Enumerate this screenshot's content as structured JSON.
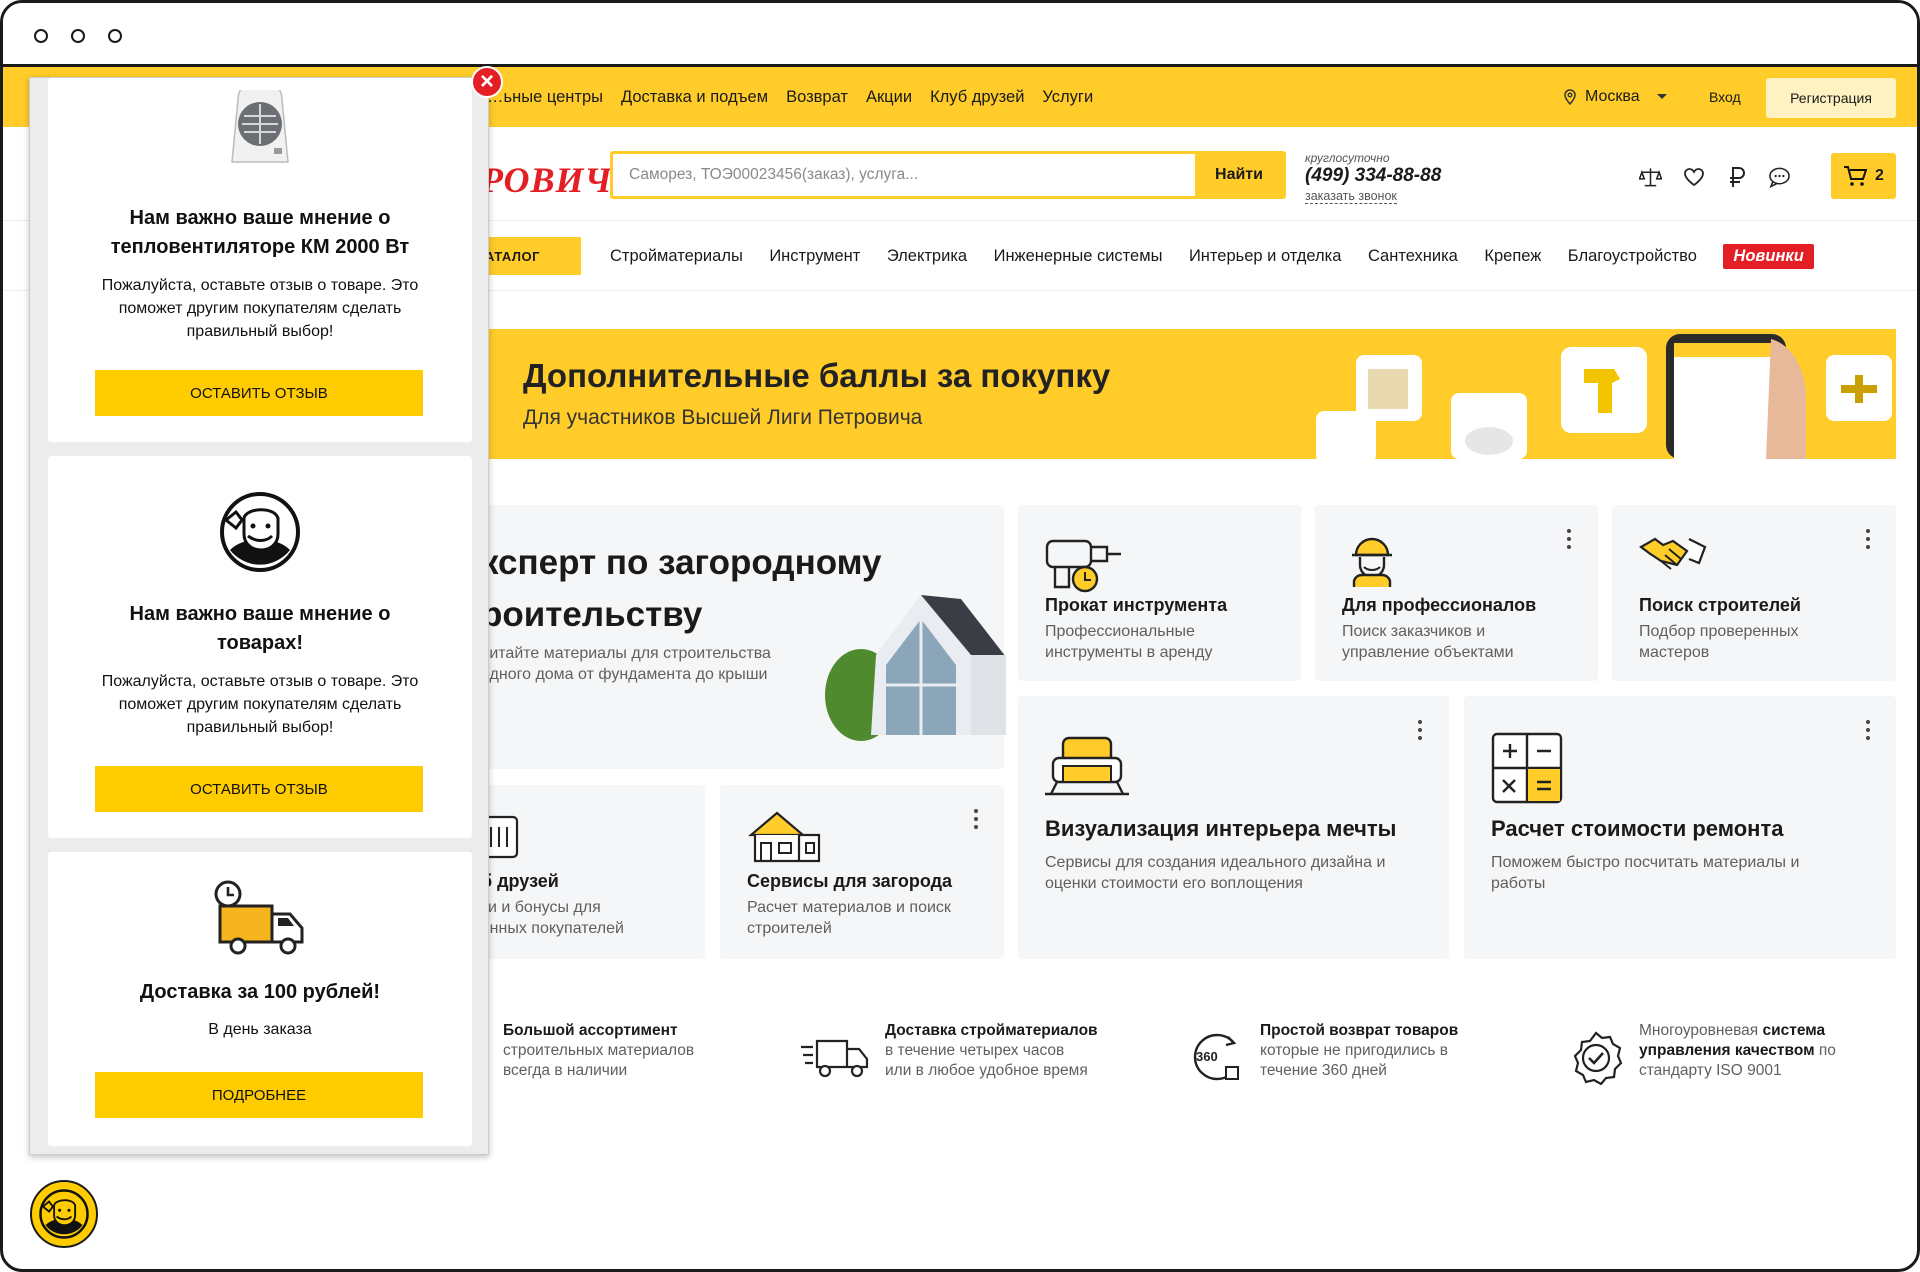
{
  "topbar": {
    "nav": [
      "…ьные центры",
      "Доставка и подъем",
      "Возврат",
      "Акции",
      "Клуб друзей",
      "Услуги"
    ],
    "city": "Москва",
    "login": "Вход",
    "register": "Регистрация"
  },
  "header": {
    "logo": "РОВИЧ",
    "search_placeholder": "Саморез, ТОЭ00023456(заказ), услуга...",
    "search_button": "Найти",
    "phone_caption": "круглосуточно",
    "phone": "(499) 334-88-88",
    "callback": "заказать звонок",
    "cart_count": "2",
    "icons": [
      "compare-icon",
      "heart-icon",
      "ruble-icon",
      "chat-icon"
    ]
  },
  "catnav": {
    "catalog": "АТАЛОГ",
    "items": [
      "Стройматериалы",
      "Инструмент",
      "Электрика",
      "Инженерные системы",
      "Интерьер и отделка",
      "Сантехника",
      "Крепеж",
      "Благоустройство"
    ],
    "new_badge": "Новинки"
  },
  "banner": {
    "title": "Дополнительные баллы за покупку",
    "subtitle": "Для участников Высшей Лиги Петровича"
  },
  "hero": {
    "title_line1": "ксперт по загородному",
    "title_line2": "роительству",
    "sub_line1": "читайте материалы для строительства",
    "sub_line2": "одного дома от фундамента до крыши"
  },
  "services": [
    {
      "title": "Прокат инструмента",
      "sub1": "Профессиональные",
      "sub2": "инструменты в аренду"
    },
    {
      "title": "Для профессионалов",
      "sub1": "Поиск заказчиков и",
      "sub2": "управление объектами"
    },
    {
      "title": "Поиск строителей",
      "sub1": "Подбор проверенных",
      "sub2": "мастеров"
    },
    {
      "title": "Визуализация интерьера мечты",
      "sub1": "Сервисы для создания идеального дизайна и",
      "sub2": "оценки стоимости его воплощения"
    },
    {
      "title": "Расчет стоимости ремонта",
      "sub1": "Поможем быстро посчитать материалы и",
      "sub2": "работы"
    },
    {
      "title": "б друзей",
      "sub1": "ки и бонусы для",
      "sub2": "янных покупателей"
    },
    {
      "title": "Сервисы для загорода",
      "sub1": "Расчет материалов и поиск",
      "sub2": "строителей"
    }
  ],
  "features": [
    {
      "bold": "Большой ассортимент",
      "line2": "строительных материалов",
      "line3": "всегда в наличии"
    },
    {
      "bold": "Доставка стройматериалов",
      "line2": "в течение четырех часов",
      "line3": "или в любое удобное время"
    },
    {
      "bold": "Простой возврат товаров",
      "line2": "которые не пригодились в",
      "line3": "течение 360 дней"
    },
    {
      "pre": "Многоуровневая ",
      "bold": "система",
      "bold2": "управления качеством",
      "post": " по",
      "line3": "стандарту ISO 9001"
    }
  ],
  "popup": {
    "cards": [
      {
        "title": "Нам важно ваше мнение о тепловентиляторе КМ 2000 Вт",
        "text": "Пожалуйста, оставьте отзыв о товаре. Это поможет другим покупателям сделать правильный выбор!",
        "button": "ОСТАВИТЬ ОТЗЫВ"
      },
      {
        "title": "Нам важно ваше мнение о товарах!",
        "text": "Пожалуйста, оставьте отзыв о товаре. Это поможет другим покупателям сделать правильный выбор!",
        "button": "ОСТАВИТЬ ОТЗЫВ"
      },
      {
        "title": "Доставка за 100 рублей!",
        "text": "В день заказа",
        "button": "ПОДРОБНЕЕ"
      }
    ]
  },
  "colors": {
    "brand_yellow": "#ffcc29",
    "brand_red": "#e31e24"
  }
}
